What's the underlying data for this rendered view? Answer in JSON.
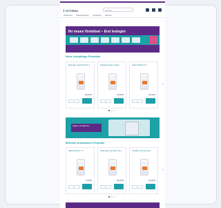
{
  "header": {
    "brand": "ISTOBAL",
    "search_placeholder": "Suchen...",
    "nav": [
      "Sortiment",
      "Anwendungen",
      "Angebote",
      "Service"
    ]
  },
  "hero1": {
    "title": "Ihr neues Vorteilset – Erst loslegen"
  },
  "section1": {
    "title": "Neue Autopflege-Produkte"
  },
  "products1": [
    {
      "name": "Reiniger Konzentrat 5 L",
      "price": "29,90 €",
      "qty": "1"
    },
    {
      "name": "Felgenreiniger Spray",
      "price": "12,50 €",
      "qty": "1"
    },
    {
      "name": "Glanz-Politur 5 L",
      "price": "34,90 €",
      "qty": "1"
    }
  ],
  "hero2": {
    "text": "Sparen & Glänzen"
  },
  "section2": {
    "title": "Beliebte Autowasch-Produkte"
  },
  "products2": [
    {
      "name": "Aktivschaum 1 L",
      "price": "9,90 €",
      "qty": "1"
    },
    {
      "name": "Shampoo Kanister 10 L",
      "price": "44,90 €",
      "qty": "1"
    },
    {
      "name": "Trockner Konzentrat",
      "price": "19,90 €",
      "qty": "1"
    }
  ],
  "colors": {
    "brand_purple": "#5b2a86",
    "teal": "#1ea0a8",
    "accent": "#e84c87"
  }
}
